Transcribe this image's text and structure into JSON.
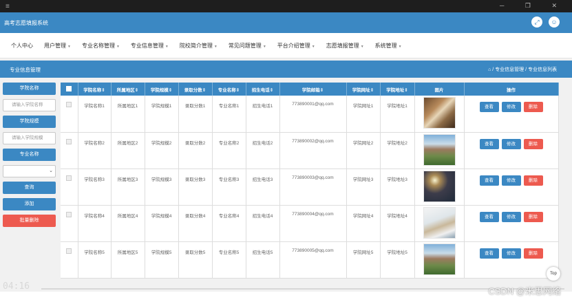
{
  "titlebar": {
    "controls": "─ ❐ ✕"
  },
  "header": {
    "brand": "高考志愿填报系统"
  },
  "nav": {
    "items": [
      "个人中心",
      "用户管理",
      "专业名称管理",
      "专业信息管理",
      "院校简介管理",
      "常见问题管理",
      "平台介绍管理",
      "志愿填报管理",
      "系统管理"
    ]
  },
  "crumbbar": {
    "title": "专业信息管理",
    "crumb": "⌂ / 专业信息管理 / 专业信息列表"
  },
  "sidebar": {
    "school_name_label": "学院名称",
    "school_name_placeholder": "请输入学院名称",
    "school_scale_label": "学院规模",
    "school_scale_placeholder": "请输入学院规模",
    "major_label": "专业名称",
    "query_button": "查询",
    "add_button": "添加",
    "batch_delete_button": "批量删除"
  },
  "table": {
    "headers": [
      "学院名称⇕",
      "所属地区⇕",
      "学院规模⇕",
      "录取分数⇕",
      "专业名称⇕",
      "招生电话⇕",
      "学院邮箱⇕",
      "学院网址⇕",
      "学院地址⇕",
      "图片",
      "操作"
    ],
    "actions": {
      "view": "查看",
      "edit": "修改",
      "delete": "删除"
    },
    "rows": [
      {
        "c": [
          "学院名称1",
          "所属地区1",
          "学院规模1",
          "录取分数1",
          "专业名称1",
          "招生电话1",
          "773890001@qq.com",
          "学院网址1",
          "学院地址1"
        ],
        "img": "dorm-photo"
      },
      {
        "c": [
          "学院名称2",
          "所属地区2",
          "学院规模2",
          "录取分数2",
          "专业名称2",
          "招生电话2",
          "773890002@qq.com",
          "学院网址2",
          "学院地址2"
        ],
        "img": "campus-photo"
      },
      {
        "c": [
          "学院名称3",
          "所属地区3",
          "学院规模3",
          "录取分数3",
          "专业名称3",
          "招生电话3",
          "773890003@qq.com",
          "学院网址3",
          "学院地址3"
        ],
        "img": "night-field-photo"
      },
      {
        "c": [
          "学院名称4",
          "所属地区4",
          "学院规模4",
          "录取分数4",
          "专业名称4",
          "招生电话4",
          "773890004@qq.com",
          "学院网址4",
          "学院地址4"
        ],
        "img": "book-illustration"
      },
      {
        "c": [
          "学院名称5",
          "所属地区5",
          "学院规模5",
          "录取分数5",
          "专业名称5",
          "招生电话5",
          "773890005@qq.com",
          "学院网址5",
          "学院地址5"
        ],
        "img": "campus-photo"
      }
    ]
  },
  "top_button": "Top",
  "overlay": {
    "time": "04:16",
    "watermark": "CSDN @米思网络"
  },
  "colors": {
    "primary": "#3b88c3",
    "danger": "#ed5a4f"
  }
}
